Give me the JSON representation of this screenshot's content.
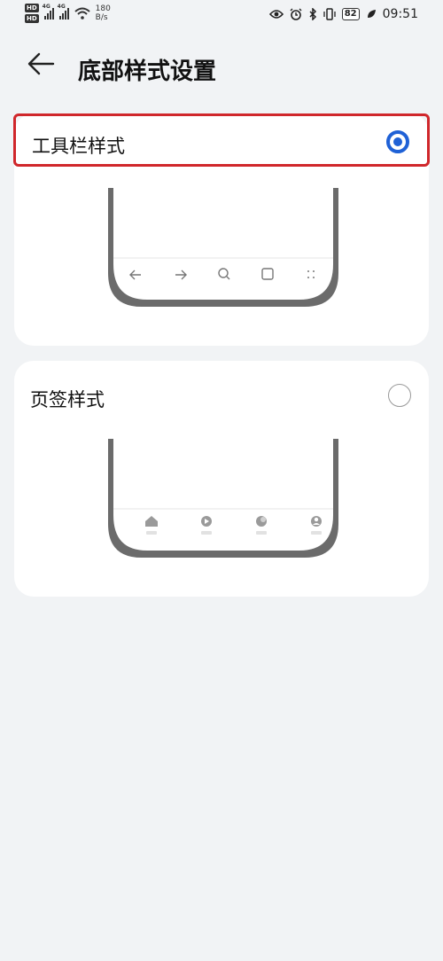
{
  "status_bar": {
    "sim1": "HD",
    "sim2": "HD",
    "network1": "4G",
    "network2": "4G",
    "speed_value": "180",
    "speed_unit": "B/s",
    "battery": "82",
    "time": "09:51"
  },
  "header": {
    "title": "底部样式设置"
  },
  "options": [
    {
      "label": "工具栏样式",
      "selected": true
    },
    {
      "label": "页签样式",
      "selected": false
    }
  ],
  "colors": {
    "accent": "#1f61d6",
    "highlight": "#d0272b",
    "background": "#f1f3f5",
    "card": "#ffffff",
    "phone_frame": "#6b6b6b"
  },
  "icons": {
    "toolbar_preview": [
      "back-arrow-icon",
      "forward-arrow-icon",
      "search-icon",
      "tabs-square-icon",
      "menu-dots-icon"
    ],
    "tab_preview": [
      "home-icon",
      "video-play-icon",
      "discover-icon",
      "profile-icon"
    ]
  }
}
